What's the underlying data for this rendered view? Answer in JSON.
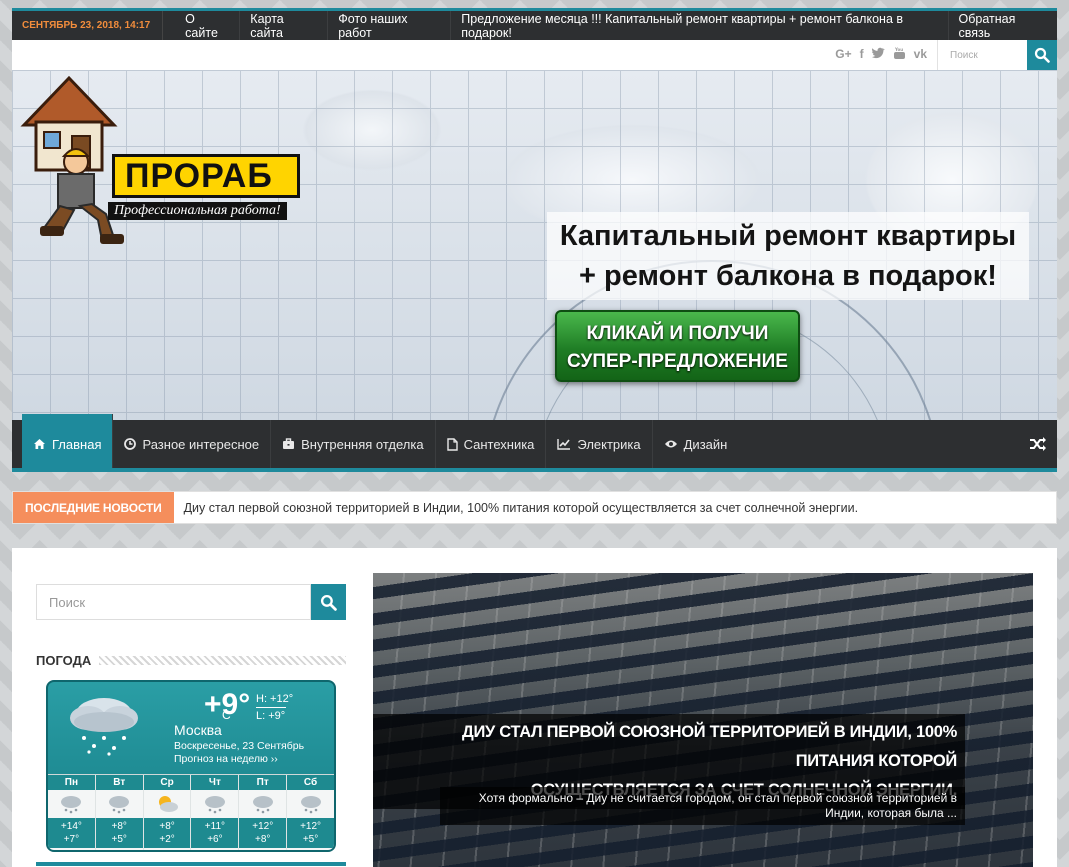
{
  "topbar": {
    "date": "Сентябрь 23, 2018, 14:17",
    "links": [
      "О сайте",
      "Карта сайта",
      "Фото наших работ",
      "Предложение месяца !!! Капитальный ремонт квартиры + ремонт балкона в подарок!",
      "Обратная связь"
    ]
  },
  "social": {
    "icons": [
      "google-plus-icon",
      "facebook-icon",
      "twitter-icon",
      "youtube-icon",
      "vk-icon"
    ],
    "search_placeholder": "Поиск"
  },
  "banner": {
    "logo_text": "ПРОРАБ",
    "logo_tagline": "Профессиональная работа!",
    "headline_line1": "Капитальный ремонт квартиры",
    "headline_line2": "+ ремонт балкона в подарок!",
    "cta_line1": "КЛИКАЙ И ПОЛУЧИ",
    "cta_line2": "СУПЕР-ПРЕДЛОЖЕНИЕ"
  },
  "mainnav": {
    "items": [
      {
        "label": "Главная",
        "icon": "home-icon"
      },
      {
        "label": "Разное интересное",
        "icon": "clock-icon"
      },
      {
        "label": "Внутренняя отделка",
        "icon": "briefcase-icon"
      },
      {
        "label": "Сантехника",
        "icon": "file-icon"
      },
      {
        "label": "Электрика",
        "icon": "chart-icon"
      },
      {
        "label": "Дизайн",
        "icon": "eye-icon"
      }
    ]
  },
  "ticker": {
    "label": "Последние новости",
    "text": "Диу стал первой союзной территорией в Индии, 100% питания которой осуществляется за счет солнечной энергии."
  },
  "sidebar": {
    "search_placeholder": "Поиск",
    "weather_title": "Погода",
    "weather": {
      "temp": "+9°",
      "unit": "C",
      "high": "H: +12°",
      "low": "L: +9°",
      "city": "Москва",
      "day": "Воскресенье, 23 Сентябрь",
      "week_link": "Прогноз на неделю ››",
      "forecast": [
        {
          "day": "Пн",
          "hi": "+14°",
          "lo": "+7°"
        },
        {
          "day": "Вт",
          "hi": "+8°",
          "lo": "+5°"
        },
        {
          "day": "Ср",
          "hi": "+8°",
          "lo": "+2°"
        },
        {
          "day": "Чт",
          "hi": "+11°",
          "lo": "+6°"
        },
        {
          "day": "Пт",
          "hi": "+12°",
          "lo": "+8°"
        },
        {
          "day": "Сб",
          "hi": "+12°",
          "lo": "+5°"
        }
      ]
    }
  },
  "feature": {
    "title_line1": "Диу стал первой союзной территорией в Индии, 100% питания которой",
    "title_line2": "осуществляется за счет солнечной энергии.",
    "excerpt_line1": "Хотя формально – Диу не считается городом, он стал первой союзной территорией в",
    "excerpt_line2": "Индии, которая была ..."
  },
  "colors": {
    "accent": "#1e8a9c",
    "dark": "#2d2f31",
    "ticker_label": "#f58e5c",
    "date": "#f28d3c"
  }
}
